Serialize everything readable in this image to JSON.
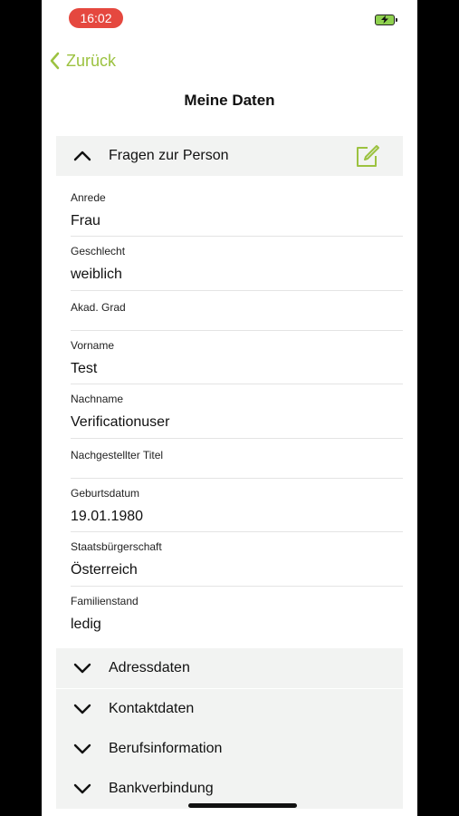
{
  "status_bar": {
    "time": "16:02"
  },
  "nav": {
    "back_label": "Zurück",
    "title": "Meine Daten"
  },
  "colors": {
    "accent": "#9cc240",
    "status_time_bg": "#e5483f",
    "section_bg": "#f2f3f2"
  },
  "sections": {
    "personal": {
      "label": "Fragen zur Person",
      "expanded": true,
      "fields": [
        {
          "label": "Anrede",
          "value": "Frau"
        },
        {
          "label": "Geschlecht",
          "value": "weiblich"
        },
        {
          "label": "Akad. Grad",
          "value": ""
        },
        {
          "label": "Vorname",
          "value": "Test"
        },
        {
          "label": "Nachname",
          "value": "Verificationuser"
        },
        {
          "label": "Nachgestellter Titel",
          "value": ""
        },
        {
          "label": "Geburtsdatum",
          "value": "19.01.1980"
        },
        {
          "label": "Staatsbürgerschaft",
          "value": "Österreich"
        },
        {
          "label": "Familienstand",
          "value": "ledig"
        }
      ]
    },
    "collapsed": [
      {
        "label": "Adressdaten"
      },
      {
        "label": "Kontaktdaten"
      },
      {
        "label": "Berufsinformation"
      },
      {
        "label": "Bankverbindung"
      }
    ]
  }
}
